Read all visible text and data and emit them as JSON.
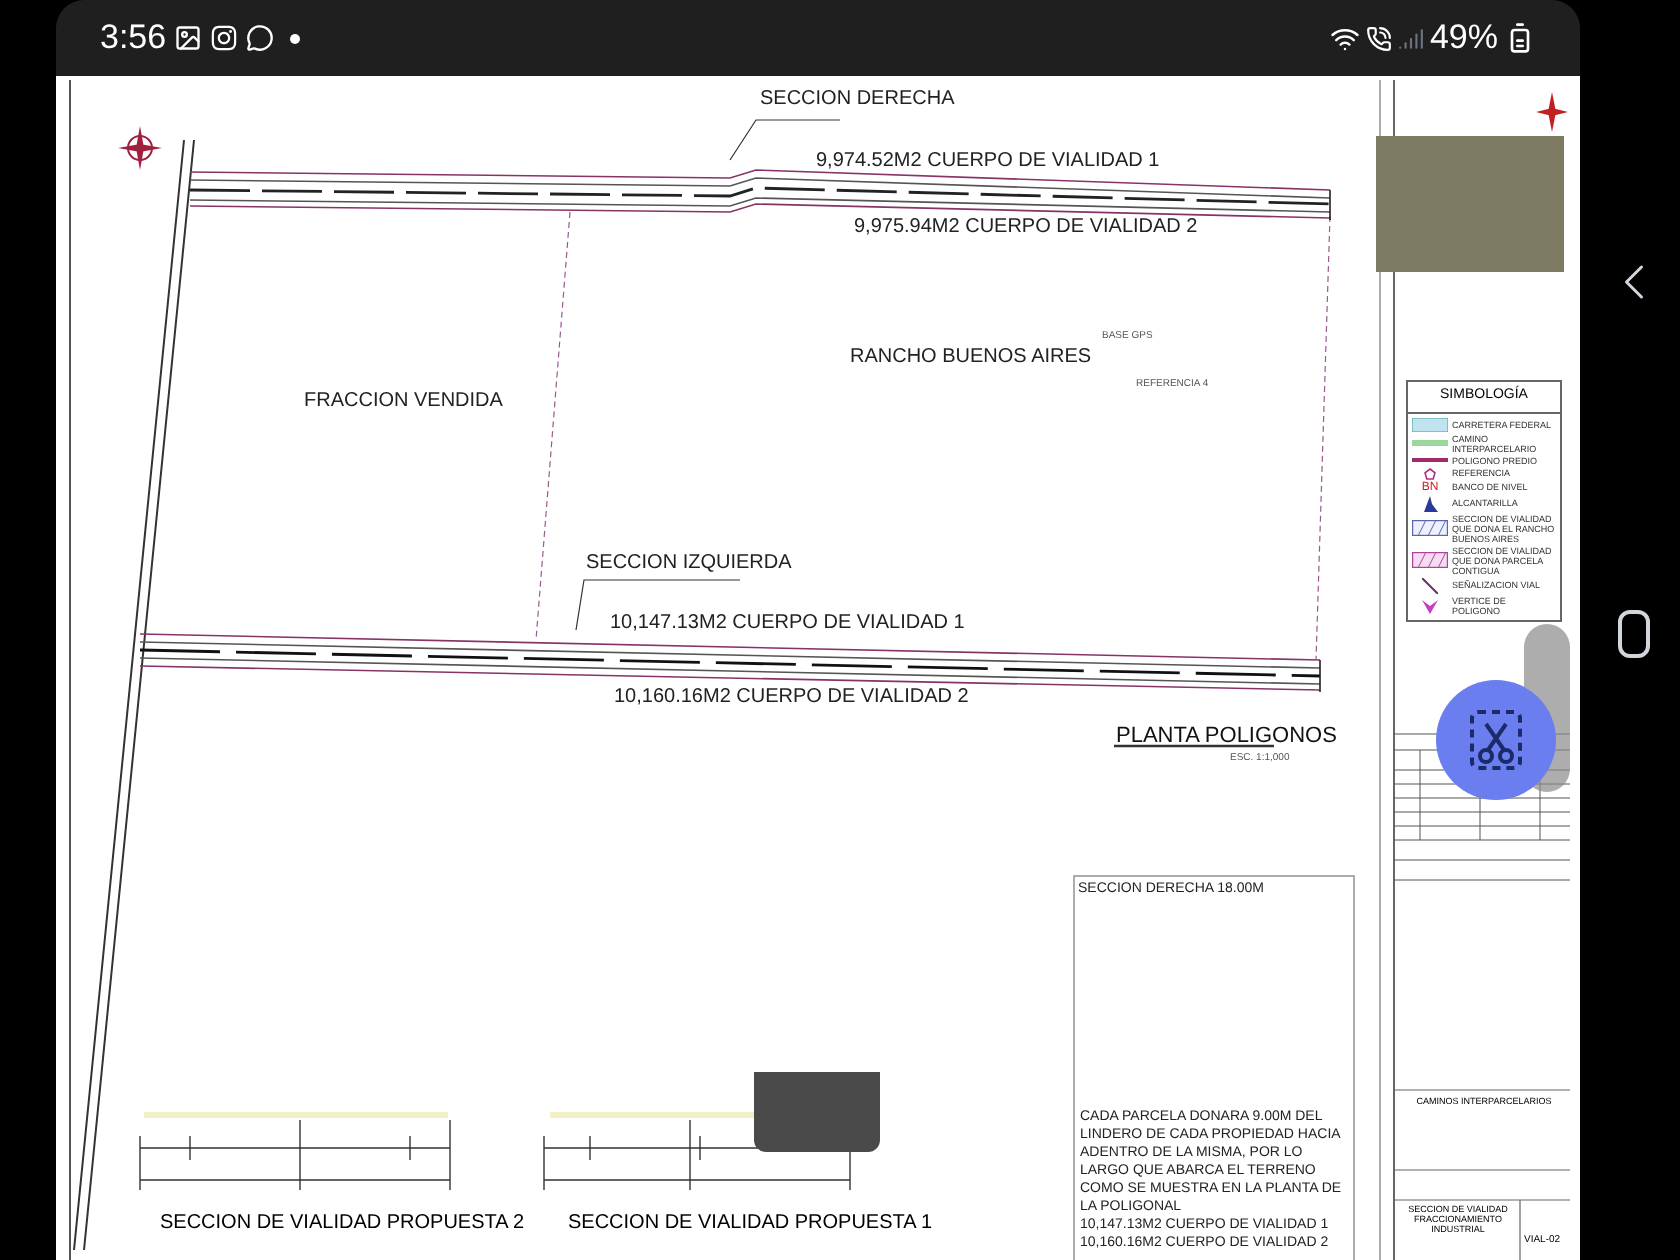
{
  "status_bar": {
    "time": "3:56",
    "battery": "49%"
  },
  "plan": {
    "labels": [
      {
        "text": "SECCION DERECHA",
        "kind": "section"
      },
      {
        "text": "9,974.52M2 CUERPO DE VIALIDAD 1",
        "kind": "area"
      },
      {
        "text": "9,975.94M2 CUERPO DE VIALIDAD 2",
        "kind": "area"
      },
      {
        "text": "RANCHO BUENOS AIRES",
        "kind": "parcel"
      },
      {
        "text": "BASE GPS",
        "kind": "small"
      },
      {
        "text": "REFERENCIA 4",
        "kind": "small"
      },
      {
        "text": "FRACCION VENDIDA",
        "kind": "parcel"
      },
      {
        "text": "SECCION IZQUIERDA",
        "kind": "section"
      },
      {
        "text": "10,147.13M2 CUERPO DE VIALIDAD 1",
        "kind": "area"
      },
      {
        "text": "10,160.16M2 CUERPO DE VIALIDAD 2",
        "kind": "area"
      }
    ],
    "title": "PLANTA POLIGONOS",
    "scale": "ESC. 1:1,000"
  },
  "legend": {
    "title": "SIMBOLOGÍA",
    "items": [
      {
        "label": "CARRETERA FEDERAL",
        "kind": "band"
      },
      {
        "label": "CAMINO INTERPARCELARIO",
        "kind": "green-line"
      },
      {
        "label": "POLIGONO PREDIO",
        "kind": "magenta-line"
      },
      {
        "label": "REFERENCIA",
        "kind": "pentagon"
      },
      {
        "label": "BANCO DE NIVEL",
        "kind": "level",
        "symbol": "BN"
      },
      {
        "label": "ALCANTARILLA",
        "kind": "culvert"
      },
      {
        "label": "SECCION DE VIALIDAD QUE DONA EL RANCHO BUENOS AIRES",
        "kind": "hatch-blue"
      },
      {
        "label": "SECCION DE VIALIDAD QUE DONA PARCELA CONTIGUA",
        "kind": "hatch-magenta"
      },
      {
        "label": "SEÑALIZACION VIAL",
        "kind": "sign"
      },
      {
        "label": "VERTICE DE POLIGONO",
        "kind": "vertex"
      }
    ]
  },
  "sections": [
    {
      "title": "SECCION DE VIALIDAD PROPUESTA 2"
    },
    {
      "title": "SECCION DE VIALIDAD PROPUESTA 1"
    }
  ],
  "notes": {
    "heading": "SECCION DERECHA 18.00M",
    "body": "CADA PARCELA DONARA 9.00M DEL LINDERO DE CADA PROPIEDAD HACIA ADENTRO DE LA MISMA, POR LO LARGO QUE ABARCA EL TERRENO COMO SE MUESTRA EN LA PLANTA DE LA POLIGONAL",
    "lines": [
      "10,147.13M2 CUERPO DE VIALIDAD 1",
      "10,160.16M2 CUERPO DE VIALIDAD 2"
    ]
  },
  "title_block": {
    "project": "CAMINOS INTERPARCELARIOS",
    "sheet_title": "SECCION DE VIALIDAD",
    "subtitle": "FRACCIONAMIENTO INDUSTRIAL",
    "sheet": "VIAL-02"
  }
}
